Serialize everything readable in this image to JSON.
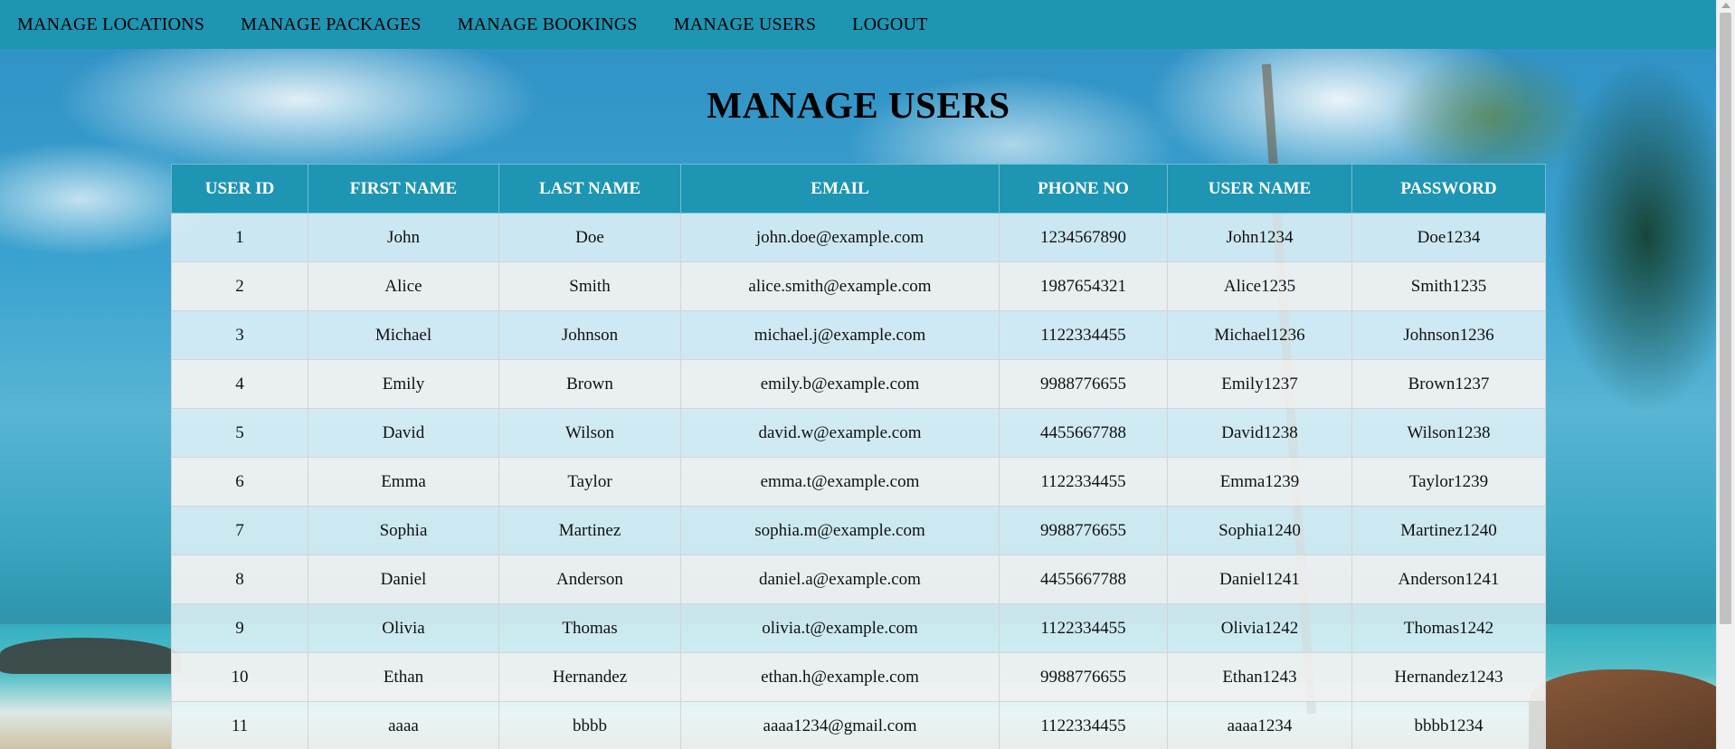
{
  "nav": {
    "items": [
      {
        "label": "MANAGE LOCATIONS"
      },
      {
        "label": "MANAGE PACKAGES"
      },
      {
        "label": "MANAGE BOOKINGS"
      },
      {
        "label": "MANAGE USERS"
      },
      {
        "label": "LOGOUT"
      }
    ]
  },
  "page": {
    "title": "MANAGE USERS"
  },
  "table": {
    "headers": [
      "USER ID",
      "FIRST NAME",
      "LAST NAME",
      "EMAIL",
      "PHONE NO",
      "USER NAME",
      "PASSWORD"
    ],
    "rows": [
      [
        "1",
        "John",
        "Doe",
        "john.doe@example.com",
        "1234567890",
        "John1234",
        "Doe1234"
      ],
      [
        "2",
        "Alice",
        "Smith",
        "alice.smith@example.com",
        "1987654321",
        "Alice1235",
        "Smith1235"
      ],
      [
        "3",
        "Michael",
        "Johnson",
        "michael.j@example.com",
        "1122334455",
        "Michael1236",
        "Johnson1236"
      ],
      [
        "4",
        "Emily",
        "Brown",
        "emily.b@example.com",
        "9988776655",
        "Emily1237",
        "Brown1237"
      ],
      [
        "5",
        "David",
        "Wilson",
        "david.w@example.com",
        "4455667788",
        "David1238",
        "Wilson1238"
      ],
      [
        "6",
        "Emma",
        "Taylor",
        "emma.t@example.com",
        "1122334455",
        "Emma1239",
        "Taylor1239"
      ],
      [
        "7",
        "Sophia",
        "Martinez",
        "sophia.m@example.com",
        "9988776655",
        "Sophia1240",
        "Martinez1240"
      ],
      [
        "8",
        "Daniel",
        "Anderson",
        "daniel.a@example.com",
        "4455667788",
        "Daniel1241",
        "Anderson1241"
      ],
      [
        "9",
        "Olivia",
        "Thomas",
        "olivia.t@example.com",
        "1122334455",
        "Olivia1242",
        "Thomas1242"
      ],
      [
        "10",
        "Ethan",
        "Hernandez",
        "ethan.h@example.com",
        "9988776655",
        "Ethan1243",
        "Hernandez1243"
      ],
      [
        "11",
        "aaaa",
        "bbbb",
        "aaaa1234@gmail.com",
        "1122334455",
        "aaaa1234",
        "bbbb1234"
      ]
    ]
  }
}
